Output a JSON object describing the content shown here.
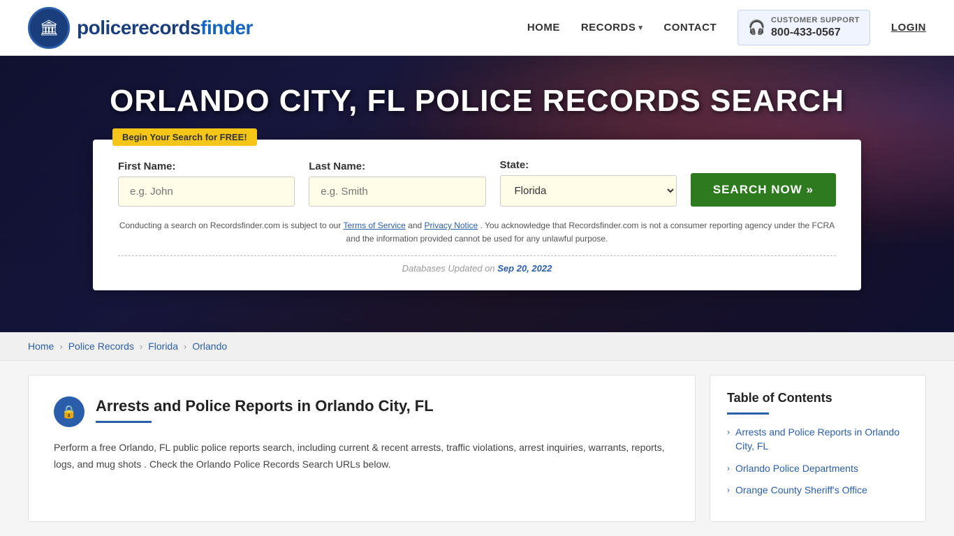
{
  "header": {
    "logo_text_normal": "policerecords",
    "logo_text_bold": "finder",
    "nav": {
      "home": "HOME",
      "records": "RECORDS",
      "contact": "CONTACT",
      "login": "LOGIN"
    },
    "support": {
      "label": "CUSTOMER SUPPORT",
      "number": "800-433-0567"
    }
  },
  "hero": {
    "title": "ORLANDO CITY, FL POLICE RECORDS SEARCH",
    "badge": "Begin Your Search for FREE!"
  },
  "form": {
    "first_name_label": "First Name:",
    "first_name_placeholder": "e.g. John",
    "last_name_label": "Last Name:",
    "last_name_placeholder": "e.g. Smith",
    "state_label": "State:",
    "state_value": "Florida",
    "search_button": "SEARCH NOW »",
    "disclaimer_text": "Conducting a search on Recordsfinder.com is subject to our",
    "disclaimer_text2": "and",
    "disclaimer_text3": ". You acknowledge that Recordsfinder.com is not a consumer reporting agency under the FCRA and the information provided cannot be used for any unlawful purpose.",
    "tos_link": "Terms of Service",
    "privacy_link": "Privacy Notice",
    "db_label": "Databases Updated on",
    "db_date": "Sep 20, 2022"
  },
  "breadcrumb": {
    "items": [
      "Home",
      "Police Records",
      "Florida",
      "Orlando"
    ]
  },
  "article": {
    "title": "Arrests and Police Reports in Orlando City, FL",
    "body": "Perform a free Orlando, FL public police reports search, including current & recent arrests, traffic violations, arrest inquiries, warrants, reports, logs, and mug shots . Check the Orlando Police Records Search URLs below.",
    "icon": "🔒"
  },
  "toc": {
    "title": "Table of Contents",
    "items": [
      "Arrests and Police Reports in Orlando City, FL",
      "Orlando Police Departments",
      "Orange County Sheriff's Office"
    ]
  }
}
